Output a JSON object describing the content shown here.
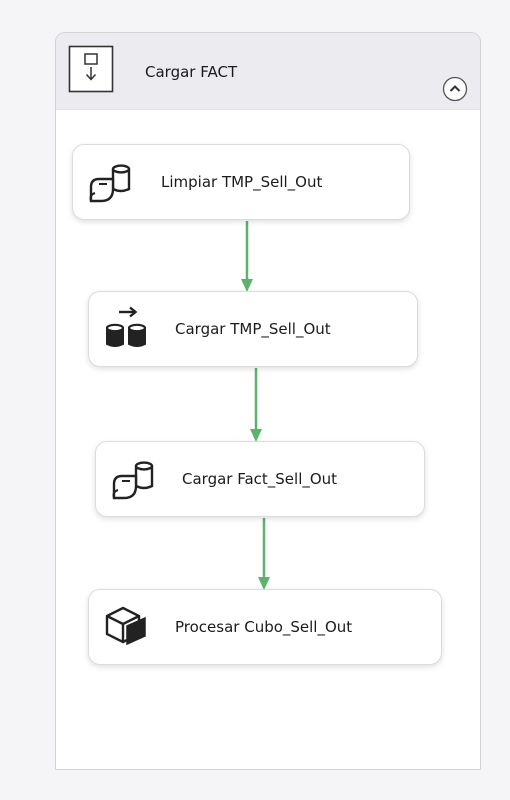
{
  "container": {
    "title": "Cargar FACT"
  },
  "tasks": [
    {
      "label": "Limpiar TMP_Sell_Out",
      "icon": "execute-sql-icon"
    },
    {
      "label": "Cargar TMP_Sell_Out",
      "icon": "data-flow-icon"
    },
    {
      "label": "Cargar Fact_Sell_Out",
      "icon": "execute-sql-icon"
    },
    {
      "label": "Procesar Cubo_Sell_Out",
      "icon": "analysis-services-icon"
    }
  ],
  "colors": {
    "connector": "#5bb36c",
    "header_background": "#ebebf0",
    "task_border": "#dcdcdc"
  }
}
